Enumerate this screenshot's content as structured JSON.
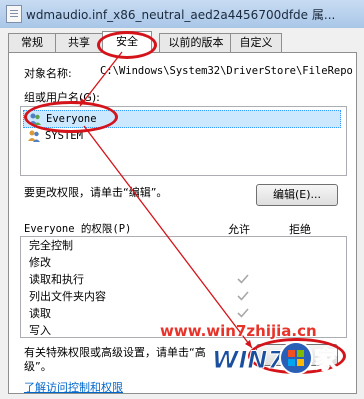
{
  "window": {
    "title": "wdmaudio.inf_x86_neutral_aed2a4456700dfde 属..."
  },
  "tabs": [
    {
      "label": "常规"
    },
    {
      "label": "共享"
    },
    {
      "label": "安全"
    },
    {
      "label": "以前的版本"
    },
    {
      "label": "自定义"
    }
  ],
  "active_tab": "安全",
  "security": {
    "object_name_label": "对象名称:",
    "object_name_value": "C:\\Windows\\System32\\DriverStore\\FileRepo",
    "group_label": "组或用户名(G):",
    "users": [
      {
        "name": "Everyone",
        "selected": true
      },
      {
        "name": "SYSTEM",
        "selected": false
      }
    ],
    "change_hint": "要更改权限，请单击“编辑”。",
    "edit_button": "编辑(E)...",
    "permissions_label": "Everyone 的权限(P)",
    "allow_header": "允许",
    "deny_header": "拒绝",
    "permissions": [
      {
        "name": "完全控制",
        "allow": false
      },
      {
        "name": "修改",
        "allow": false
      },
      {
        "name": "读取和执行",
        "allow": true
      },
      {
        "name": "列出文件夹内容",
        "allow": true
      },
      {
        "name": "读取",
        "allow": true
      },
      {
        "name": "写入",
        "allow": false
      }
    ],
    "special_hint_line1": "有关特殊权限或高级设置，请单击“高",
    "special_hint_line2": "级”。",
    "access_link": "了解访问控制和权限"
  },
  "watermark": {
    "url_text": "www.win7zhijia.cn",
    "logo_text": "WIN7",
    "logo_suffix": "家"
  },
  "colors": {
    "annotation_red": "#d4141a",
    "link_blue": "#0066cc",
    "selection_bg": "#cce8ff"
  }
}
